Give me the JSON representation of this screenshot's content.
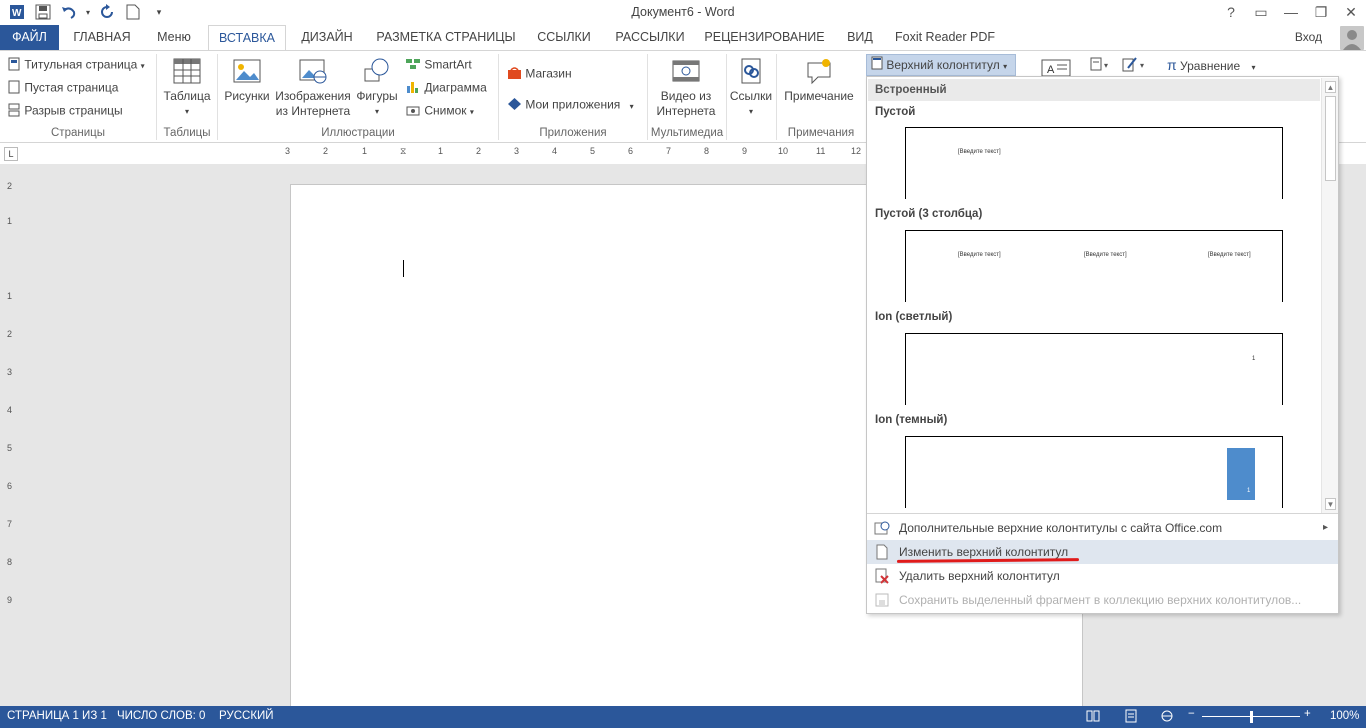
{
  "window": {
    "title": "Документ6 - Word",
    "controls": [
      "?",
      "▭",
      "—",
      "❐",
      "✕"
    ]
  },
  "tabs": {
    "file": "ФАЙЛ",
    "items": [
      "ГЛАВНАЯ",
      "Меню",
      "ВСТАВКА",
      "ДИЗАЙН",
      "РАЗМЕТКА СТРАНИЦЫ",
      "ССЫЛКИ",
      "РАССЫЛКИ",
      "РЕЦЕНЗИРОВАНИЕ",
      "ВИД",
      "Foxit Reader PDF"
    ],
    "active": "ВСТАВКА",
    "sign_in": "Вход"
  },
  "ribbon": {
    "pages": {
      "cover": "Титульная страница",
      "blank": "Пустая страница",
      "break": "Разрыв страницы",
      "label": "Страницы"
    },
    "tables": {
      "table": "Таблица",
      "label": "Таблицы"
    },
    "illustrations": {
      "pictures": "Рисунки",
      "online1": "Изображения",
      "online2": "из Интернета",
      "shapes": "Фигуры",
      "smartart": "SmartArt",
      "chart": "Диаграмма",
      "screenshot": "Снимок",
      "label": "Иллюстрации"
    },
    "apps": {
      "store": "Магазин",
      "myapps": "Мои приложения",
      "label": "Приложения"
    },
    "media": {
      "video1": "Видео из",
      "video2": "Интернета",
      "label": "Мультимедиа"
    },
    "links": {
      "links": "Ссылки"
    },
    "comments": {
      "comment": "Примечание",
      "label": "Примечания"
    },
    "header_button": "Верхний колонтитул",
    "equation": "Уравнение"
  },
  "ruler": {
    "h_numbers": [
      "3",
      "2",
      "1",
      "1",
      "2",
      "3",
      "4",
      "5",
      "6",
      "7",
      "8",
      "9",
      "10",
      "11",
      "12"
    ],
    "v_numbers": [
      "2",
      "1",
      "1",
      "2",
      "3",
      "4",
      "5",
      "6",
      "7",
      "8",
      "9"
    ]
  },
  "gallery": {
    "section": "Встроенный",
    "items": [
      {
        "title": "Пустой",
        "texts": [
          "[Введите текст]"
        ]
      },
      {
        "title": "Пустой (3 столбца)",
        "texts": [
          "[Введите текст]",
          "[Введите текст]",
          "[Введите текст]"
        ]
      },
      {
        "title": "Ion (светлый)",
        "texts": [
          "1"
        ]
      },
      {
        "title": "Ion (темный)",
        "texts": [
          "1"
        ]
      }
    ],
    "menu": [
      {
        "label": "Дополнительные верхние колонтитулы с сайта Office.com"
      },
      {
        "label": "Изменить верхний колонтитул"
      },
      {
        "label": "Удалить верхний колонтитул"
      },
      {
        "label": "Сохранить выделенный фрагмент в коллекцию верхних колонтитулов..."
      }
    ]
  },
  "status": {
    "page": "СТРАНИЦА 1 ИЗ 1",
    "words": "ЧИСЛО СЛОВ: 0",
    "lang": "РУССКИЙ",
    "zoom": "100%"
  },
  "colors": {
    "accent": "#2b579a",
    "highlight": "#dfe6ef",
    "underline": "#e01b1b",
    "ion_dark": "#4e8ccc"
  }
}
